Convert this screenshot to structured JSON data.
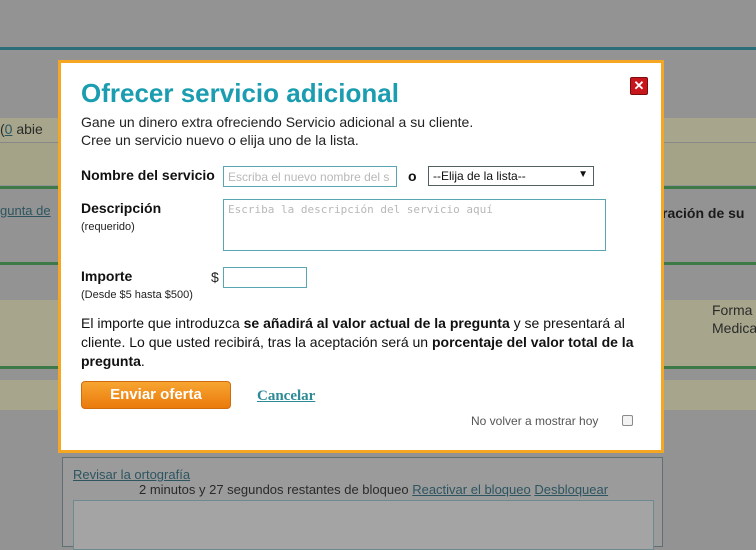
{
  "background": {
    "left_open_prefix": "(",
    "left_open_count": "0",
    "left_open_suffix": " abie",
    "left_link": "gunta de",
    "right_heading": "ración de su",
    "right_text_1": "Forma",
    "right_text_2": "Medica",
    "spell_check": "Revisar la ortografía",
    "lock_status": "2 minutos y 27 segundos restantes de bloqueo",
    "reactivate_lock": "Reactivar el bloqueo",
    "unlock": "Desbloquear"
  },
  "modal": {
    "title": "Ofrecer servicio adicional",
    "close_glyph": "✕",
    "subtitle_1": "Gane un dinero extra ofreciendo Servicio adicional a su cliente.",
    "subtitle_2": "Cree un servicio nuevo o elija uno de la lista.",
    "service_name_label": "Nombre del servicio",
    "service_name_placeholder": "Escriba el nuevo nombre del s",
    "or_label": "o",
    "select_value": "--Elija de la lista--",
    "description_label": "Descripción",
    "description_note": "(requerido)",
    "description_placeholder": "Escriba la descripción del servicio aquí",
    "amount_label": "Importe",
    "amount_note": "(Desde $5 hasta $500)",
    "currency_symbol": "$",
    "amount_value": "",
    "info_part1": "El importe que introduzca ",
    "info_bold1": "se añadirá al valor actual de la pregunta",
    "info_part2": " y se presentará al cliente. Lo que usted recibirá, tras la aceptación será un ",
    "info_bold2": "porcentaje del valor total de la pregunta",
    "info_part3": ".",
    "submit_label": "Enviar oferta",
    "cancel_label": "Cancelar",
    "dont_show_label": "No volver a mostrar hoy"
  },
  "colors": {
    "modal_border": "#f5a623",
    "title": "#1a9db0",
    "submit_button": "#f08c1e",
    "close_button": "#c8161d"
  }
}
